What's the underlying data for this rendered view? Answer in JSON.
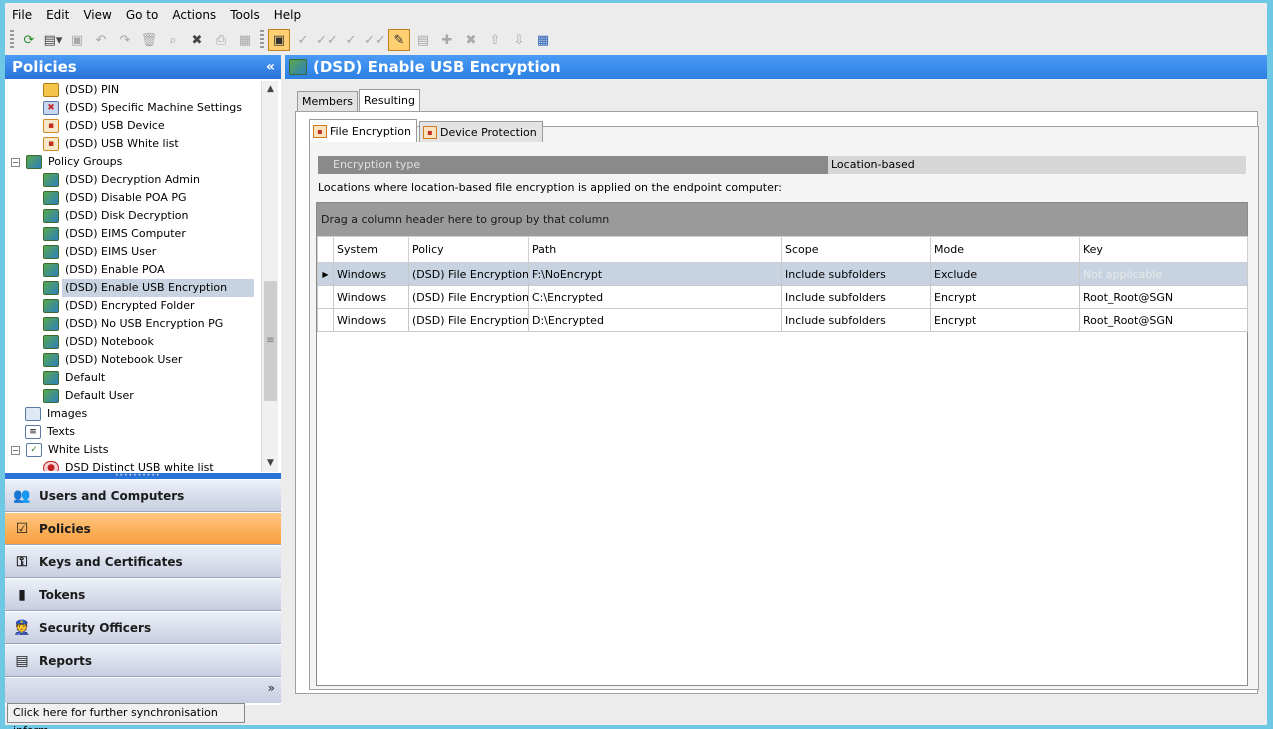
{
  "menu": [
    "File",
    "Edit",
    "View",
    "Go to",
    "Actions",
    "Tools",
    "Help"
  ],
  "left_panel": {
    "title": "Policies",
    "collapse_glyph": "«",
    "tree": [
      {
        "label": "(DSD) PIN",
        "icon": "pin-icon"
      },
      {
        "label": "(DSD) Specific Machine Settings",
        "icon": "machine-settings-icon"
      },
      {
        "label": "(DSD) USB Device",
        "icon": "usb-device-icon"
      },
      {
        "label": "(DSD) USB White list",
        "icon": "usb-whitelist-icon"
      },
      {
        "label": "Policy Groups",
        "icon": "policy-group-icon"
      },
      {
        "label": "(DSD) Decryption Admin",
        "icon": "policy-group-icon"
      },
      {
        "label": "(DSD) Disable POA PG",
        "icon": "policy-group-icon"
      },
      {
        "label": "(DSD) Disk Decryption",
        "icon": "policy-group-icon"
      },
      {
        "label": "(DSD) EIMS Computer",
        "icon": "policy-group-icon"
      },
      {
        "label": "(DSD) EIMS User",
        "icon": "policy-group-icon"
      },
      {
        "label": "(DSD) Enable POA",
        "icon": "policy-group-icon"
      },
      {
        "label": "(DSD) Enable USB Encryption",
        "icon": "policy-group-icon"
      },
      {
        "label": "(DSD) Encrypted Folder",
        "icon": "policy-group-icon"
      },
      {
        "label": "(DSD) No USB Encryption PG",
        "icon": "policy-group-icon"
      },
      {
        "label": "(DSD) Notebook",
        "icon": "policy-group-icon"
      },
      {
        "label": "(DSD) Notebook User",
        "icon": "policy-group-icon"
      },
      {
        "label": "Default",
        "icon": "policy-group-icon"
      },
      {
        "label": "Default User",
        "icon": "policy-group-icon"
      },
      {
        "label": "Images",
        "icon": "images-icon"
      },
      {
        "label": "Texts",
        "icon": "texts-icon"
      },
      {
        "label": "White Lists",
        "icon": "whitelists-icon"
      },
      {
        "label": "DSD Distinct USB white list",
        "icon": "usb-whitelist-item-icon"
      }
    ],
    "nav": [
      {
        "label": "Users and Computers",
        "icon": "users-icon"
      },
      {
        "label": "Policies",
        "icon": "policies-icon"
      },
      {
        "label": "Keys and Certificates",
        "icon": "keys-icon"
      },
      {
        "label": "Tokens",
        "icon": "tokens-icon"
      },
      {
        "label": "Security Officers",
        "icon": "security-officers-icon"
      },
      {
        "label": "Reports",
        "icon": "reports-icon"
      }
    ],
    "status": "Click here for further synchronisation inform..."
  },
  "right_panel": {
    "title": "(DSD) Enable USB Encryption",
    "outer_tabs": [
      "Members",
      "Resulting"
    ],
    "inner_tabs": [
      "File Encryption",
      "Device Protection"
    ],
    "encryption_type_label": "Encryption type",
    "encryption_type_value": "Location-based",
    "locations_text": "Locations where location-based file encryption is applied on the endpoint computer:",
    "group_hint": "Drag a column header here to group by that column",
    "columns": [
      "System",
      "Policy",
      "Path",
      "Scope",
      "Mode",
      "Key"
    ],
    "rows": [
      [
        "Windows",
        "(DSD) File Encryption",
        "F:\\NoEncrypt",
        "Include subfolders",
        "Exclude",
        "Not applicable"
      ],
      [
        "Windows",
        "(DSD) File Encryption",
        "C:\\Encrypted",
        "Include subfolders",
        "Encrypt",
        "Root_Root@SGN"
      ],
      [
        "Windows",
        "(DSD) File Encryption",
        "D:\\Encrypted",
        "Include subfolders",
        "Encrypt",
        "Root_Root@SGN"
      ]
    ]
  },
  "colors": {
    "header_blue": "#2b80e2",
    "active_nav": "#f79e3e",
    "selection": "#c8d3e1"
  }
}
